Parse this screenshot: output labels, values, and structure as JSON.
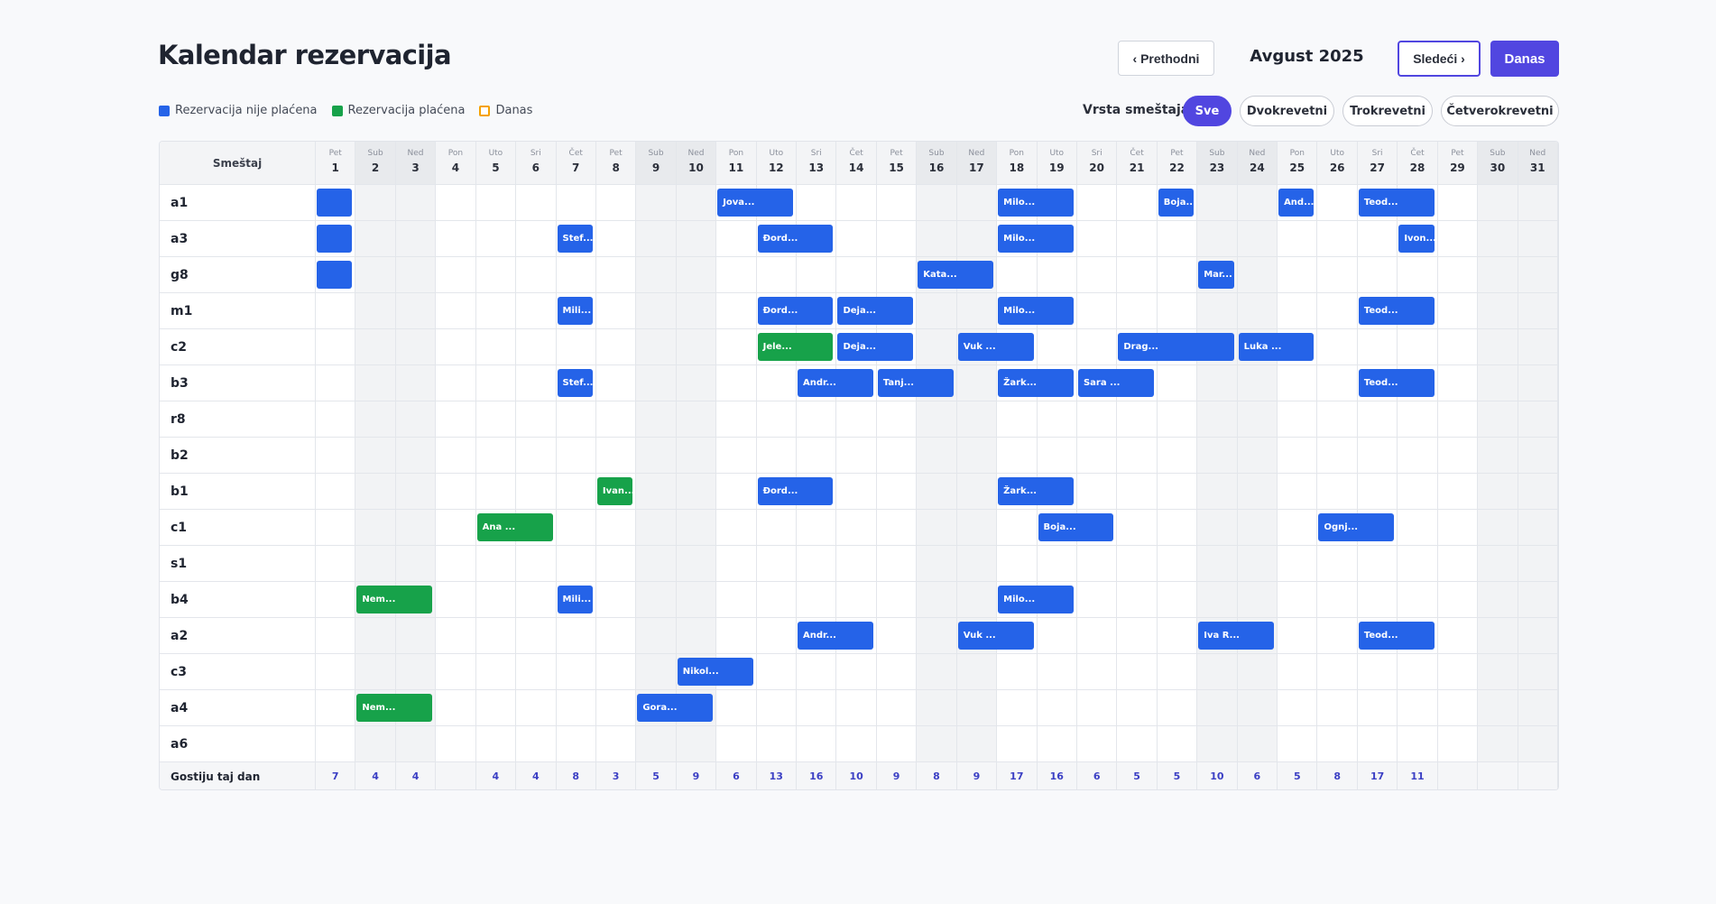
{
  "page": {
    "title": "Kalendar rezervacija"
  },
  "nav": {
    "prev_label": "‹ Prethodni",
    "month": "Avgust 2025",
    "next_label": "Sledeći ›",
    "today_label": "Danas"
  },
  "legend": [
    {
      "label": "Rezervacija nije plaćena",
      "color": "#2563e8"
    },
    {
      "label": "Rezervacija plaćena",
      "color": "#17a24a"
    },
    {
      "label": "Danas",
      "color": "#f5a100"
    }
  ],
  "filter": {
    "label": "Vrsta smeštaja:",
    "options": [
      "Sve",
      "Dvokrevetni",
      "Trokrevetni",
      "Četverokrevetni"
    ],
    "selected": "Sve"
  },
  "calendar": {
    "corner_label": "Smeštaj",
    "days": [
      {
        "n": "1",
        "d": "Pet"
      },
      {
        "n": "2",
        "d": "Sub"
      },
      {
        "n": "3",
        "d": "Ned"
      },
      {
        "n": "4",
        "d": "Pon"
      },
      {
        "n": "5",
        "d": "Uto"
      },
      {
        "n": "6",
        "d": "Sri"
      },
      {
        "n": "7",
        "d": "Čet"
      },
      {
        "n": "8",
        "d": "Pet"
      },
      {
        "n": "9",
        "d": "Sub"
      },
      {
        "n": "10",
        "d": "Ned"
      },
      {
        "n": "11",
        "d": "Pon"
      },
      {
        "n": "12",
        "d": "Uto"
      },
      {
        "n": "13",
        "d": "Sri"
      },
      {
        "n": "14",
        "d": "Čet"
      },
      {
        "n": "15",
        "d": "Pet"
      },
      {
        "n": "16",
        "d": "Sub"
      },
      {
        "n": "17",
        "d": "Ned"
      },
      {
        "n": "18",
        "d": "Pon"
      },
      {
        "n": "19",
        "d": "Uto"
      },
      {
        "n": "20",
        "d": "Sri"
      },
      {
        "n": "21",
        "d": "Čet"
      },
      {
        "n": "22",
        "d": "Pet"
      },
      {
        "n": "23",
        "d": "Sub"
      },
      {
        "n": "24",
        "d": "Ned"
      },
      {
        "n": "25",
        "d": "Pon"
      },
      {
        "n": "26",
        "d": "Uto"
      },
      {
        "n": "27",
        "d": "Sri"
      },
      {
        "n": "28",
        "d": "Čet"
      },
      {
        "n": "29",
        "d": "Pet"
      },
      {
        "n": "30",
        "d": "Sub"
      },
      {
        "n": "31",
        "d": "Ned"
      }
    ],
    "rooms": [
      "a1",
      "a3",
      "g8",
      "m1",
      "c2",
      "b3",
      "r8",
      "b2",
      "b1",
      "c1",
      "s1",
      "b4",
      "a2",
      "c3",
      "a4",
      "a6"
    ],
    "bookings": [
      {
        "room": "a1",
        "start": 1,
        "end": 1,
        "label": "",
        "paid": false
      },
      {
        "room": "a1",
        "start": 11,
        "end": 12,
        "label": "Jova...",
        "paid": false
      },
      {
        "room": "a1",
        "start": 18,
        "end": 19,
        "label": "Milo...",
        "paid": false
      },
      {
        "room": "a1",
        "start": 22,
        "end": 22,
        "label": "Boja...",
        "paid": false
      },
      {
        "room": "a1",
        "start": 25,
        "end": 25,
        "label": "And...",
        "paid": false
      },
      {
        "room": "a1",
        "start": 27,
        "end": 28,
        "label": "Teod...",
        "paid": false
      },
      {
        "room": "a3",
        "start": 1,
        "end": 1,
        "label": "",
        "paid": false
      },
      {
        "room": "a3",
        "start": 7,
        "end": 7,
        "label": "Stef...",
        "paid": false
      },
      {
        "room": "a3",
        "start": 12,
        "end": 13,
        "label": "Đord...",
        "paid": false
      },
      {
        "room": "a3",
        "start": 18,
        "end": 19,
        "label": "Milo...",
        "paid": false
      },
      {
        "room": "a3",
        "start": 28,
        "end": 28,
        "label": "Ivon...",
        "paid": false
      },
      {
        "room": "g8",
        "start": 1,
        "end": 1,
        "label": "",
        "paid": false
      },
      {
        "room": "g8",
        "start": 16,
        "end": 17,
        "label": "Kata...",
        "paid": false
      },
      {
        "room": "g8",
        "start": 23,
        "end": 23,
        "label": "Mar...",
        "paid": false
      },
      {
        "room": "m1",
        "start": 7,
        "end": 7,
        "label": "Mili...",
        "paid": false
      },
      {
        "room": "m1",
        "start": 12,
        "end": 13,
        "label": "Đord...",
        "paid": false
      },
      {
        "room": "m1",
        "start": 14,
        "end": 15,
        "label": "Deja...",
        "paid": false
      },
      {
        "room": "m1",
        "start": 18,
        "end": 19,
        "label": "Milo...",
        "paid": false
      },
      {
        "room": "m1",
        "start": 27,
        "end": 28,
        "label": "Teod...",
        "paid": false
      },
      {
        "room": "c2",
        "start": 12,
        "end": 13,
        "label": "Jele...",
        "paid": true
      },
      {
        "room": "c2",
        "start": 14,
        "end": 15,
        "label": "Deja...",
        "paid": false
      },
      {
        "room": "c2",
        "start": 17,
        "end": 18,
        "label": "Vuk ...",
        "paid": false
      },
      {
        "room": "c2",
        "start": 21,
        "end": 23,
        "label": "Drag...",
        "paid": false
      },
      {
        "room": "c2",
        "start": 24,
        "end": 25,
        "label": "Luka ...",
        "paid": false
      },
      {
        "room": "b3",
        "start": 7,
        "end": 7,
        "label": "Stef...",
        "paid": false
      },
      {
        "room": "b3",
        "start": 13,
        "end": 14,
        "label": "Andr...",
        "paid": false
      },
      {
        "room": "b3",
        "start": 15,
        "end": 16,
        "label": "Tanj...",
        "paid": false
      },
      {
        "room": "b3",
        "start": 18,
        "end": 19,
        "label": "Žark...",
        "paid": false
      },
      {
        "room": "b3",
        "start": 20,
        "end": 21,
        "label": "Sara ...",
        "paid": false
      },
      {
        "room": "b3",
        "start": 27,
        "end": 28,
        "label": "Teod...",
        "paid": false
      },
      {
        "room": "b1",
        "start": 8,
        "end": 8,
        "label": "Ivan...",
        "paid": true
      },
      {
        "room": "b1",
        "start": 12,
        "end": 13,
        "label": "Đord...",
        "paid": false
      },
      {
        "room": "b1",
        "start": 18,
        "end": 19,
        "label": "Žark...",
        "paid": false
      },
      {
        "room": "c1",
        "start": 5,
        "end": 6,
        "label": "Ana ...",
        "paid": true
      },
      {
        "room": "c1",
        "start": 19,
        "end": 20,
        "label": "Boja...",
        "paid": false
      },
      {
        "room": "c1",
        "start": 26,
        "end": 27,
        "label": "Ognj...",
        "paid": false
      },
      {
        "room": "b4",
        "start": 2,
        "end": 3,
        "label": "Nem...",
        "paid": true
      },
      {
        "room": "b4",
        "start": 7,
        "end": 7,
        "label": "Mili...",
        "paid": false
      },
      {
        "room": "b4",
        "start": 18,
        "end": 19,
        "label": "Milo...",
        "paid": false
      },
      {
        "room": "a2",
        "start": 13,
        "end": 14,
        "label": "Andr...",
        "paid": false
      },
      {
        "room": "a2",
        "start": 17,
        "end": 18,
        "label": "Vuk ...",
        "paid": false
      },
      {
        "room": "a2",
        "start": 23,
        "end": 24,
        "label": "Iva R...",
        "paid": false
      },
      {
        "room": "a2",
        "start": 27,
        "end": 28,
        "label": "Teod...",
        "paid": false
      },
      {
        "room": "c3",
        "start": 10,
        "end": 11,
        "label": "Nikol...",
        "paid": false
      },
      {
        "room": "a4",
        "start": 2,
        "end": 3,
        "label": "Nem...",
        "paid": true
      },
      {
        "room": "a4",
        "start": 9,
        "end": 10,
        "label": "Gora...",
        "paid": false
      }
    ],
    "footer_label": "Gostiju taj dan",
    "guests_per_day": [
      "7",
      "4",
      "4",
      "",
      "4",
      "4",
      "8",
      "3",
      "5",
      "9",
      "6",
      "13",
      "16",
      "10",
      "9",
      "8",
      "9",
      "17",
      "16",
      "6",
      "5",
      "5",
      "10",
      "6",
      "5",
      "8",
      "17",
      "11",
      "",
      "",
      ""
    ]
  }
}
